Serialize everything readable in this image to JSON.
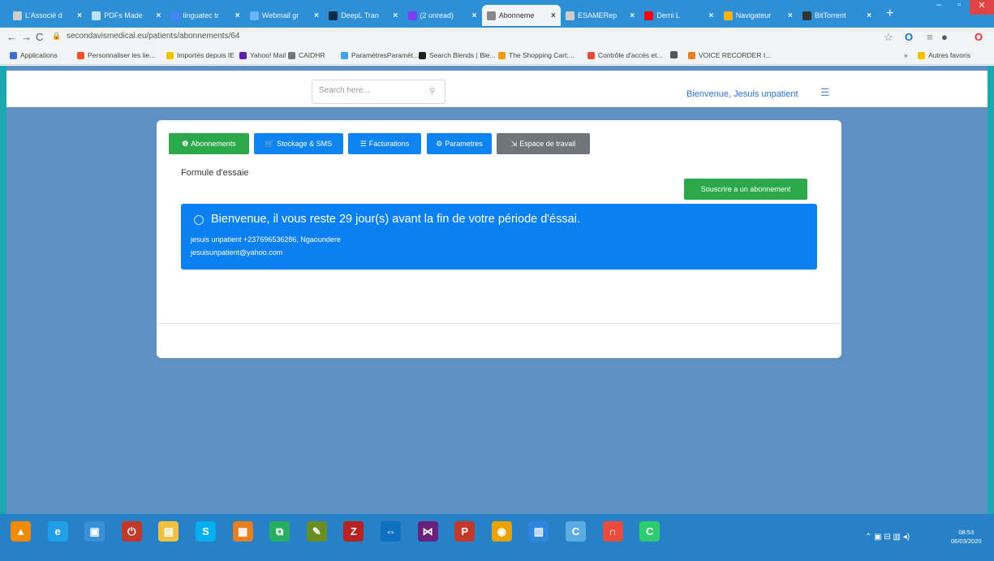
{
  "browser": {
    "tabs": [
      {
        "title": "L'Associé d",
        "fav": "#cccccc"
      },
      {
        "title": "PDFs Made",
        "fav": "#bfe3ff"
      },
      {
        "title": "linguatec tr",
        "fav": "#4285f4"
      },
      {
        "title": "Webmail gr",
        "fav": "#67b4ff"
      },
      {
        "title": "DeepL Tran",
        "fav": "#0f2b46"
      },
      {
        "title": "(2 unread)",
        "fav": "#7b3ff2"
      },
      {
        "title": "Abonneme",
        "fav": "#888888",
        "active": true
      },
      {
        "title": "ESAMERep",
        "fav": "#cccccc"
      },
      {
        "title": "Demi L",
        "fav": "#ff0000"
      },
      {
        "title": "Navigateur",
        "fav": "#ffb400"
      },
      {
        "title": "BitTorrent",
        "fav": "#333333"
      }
    ],
    "new_tab": "+",
    "url": "secondavismedical.eu/patients/abonnements/64",
    "bookmarks": [
      {
        "label": "Applications",
        "color": "#3c6fd1"
      },
      {
        "label": "Personnaliser les lie...",
        "color": "#f25022"
      },
      {
        "label": "Importés depuis IE",
        "color": "#f2c200"
      },
      {
        "label": "Yahoo! Mail",
        "color": "#5c1fa8"
      },
      {
        "label": "CAIDHR",
        "color": "#777777"
      },
      {
        "label": "ParamètresParamèt...",
        "color": "#3da2e8"
      },
      {
        "label": "Search Blends | Ble...",
        "color": "#222222"
      },
      {
        "label": "The Shopping Cart:...",
        "color": "#f39c12"
      },
      {
        "label": "Contrôle d'accès et...",
        "color": "#e74c3c"
      },
      {
        "label": "",
        "color": "#555555"
      },
      {
        "label": "VOICE RECORDER I...",
        "color": "#e67e22"
      }
    ],
    "bookmarks_more": "»",
    "other_bookmarks": "Autres favoris"
  },
  "topbar": {
    "search_placeholder": "Search here...",
    "welcome": "Bienvenue, Jesuis unpatient"
  },
  "tabs": [
    {
      "label": "Abonnements",
      "icon": "info-circle-icon",
      "glyph": "❶",
      "style": "green"
    },
    {
      "label": "Stockage & SMS",
      "icon": "cart-icon",
      "glyph": "🛒",
      "style": "blue"
    },
    {
      "label": "Facturations",
      "icon": "list-icon",
      "glyph": "☰",
      "style": "blue"
    },
    {
      "label": "Parametres",
      "icon": "gear-icon",
      "glyph": "⚙",
      "style": "blue"
    },
    {
      "label": "Espace de travail",
      "icon": "sign-in-icon",
      "glyph": "⇲",
      "style": "gray"
    }
  ],
  "content": {
    "plan_title": "Formule d'essaie",
    "subscribe_button": "Souscrire a un abonnement",
    "alert_message": "Bienvenue, il vous reste 29 jour(s) avant la fin de votre période d'éssai.",
    "alert_user_line": "jesuis unpatient +237696536286, Ngaoundere",
    "alert_email": "jesuisunpatient@yahoo.com"
  },
  "taskbar": {
    "apps": [
      {
        "name": "vlc-icon",
        "glyph": "▲",
        "color": "#f08a00"
      },
      {
        "name": "internet-explorer-icon",
        "glyph": "e",
        "color": "#1fa0e8"
      },
      {
        "name": "app-icon",
        "glyph": "▣",
        "color": "#3a8fd6"
      },
      {
        "name": "power-app-icon",
        "glyph": "⏻",
        "color": "#c0392b"
      },
      {
        "name": "file-explorer-icon",
        "glyph": "▤",
        "color": "#f0c040"
      },
      {
        "name": "skype-icon",
        "glyph": "S",
        "color": "#00aff0"
      },
      {
        "name": "media-app-icon",
        "glyph": "▦",
        "color": "#e67e22"
      },
      {
        "name": "network-app-icon",
        "glyph": "⧉",
        "color": "#27ae60"
      },
      {
        "name": "brush-app-icon",
        "glyph": "✎",
        "color": "#6b8e23"
      },
      {
        "name": "filezilla-icon",
        "glyph": "Z",
        "color": "#b52222"
      },
      {
        "name": "teamviewer-icon",
        "glyph": "⇔",
        "color": "#0e70c0"
      },
      {
        "name": "visual-studio-icon",
        "glyph": "⋈",
        "color": "#68217a"
      },
      {
        "name": "p-app-icon",
        "glyph": "P",
        "color": "#c0392b"
      },
      {
        "name": "chrome-icon",
        "glyph": "◉",
        "color": "#e8a300"
      },
      {
        "name": "document-app-icon",
        "glyph": "▥",
        "color": "#2e86de"
      },
      {
        "name": "c-app-icon",
        "glyph": "C",
        "color": "#5dade2"
      },
      {
        "name": "headphones-app-icon",
        "glyph": "∩",
        "color": "#e74c3c"
      },
      {
        "name": "green-c-app-icon",
        "glyph": "C",
        "color": "#2ecc71"
      }
    ],
    "time": "08:53",
    "date": "06/03/2020"
  }
}
